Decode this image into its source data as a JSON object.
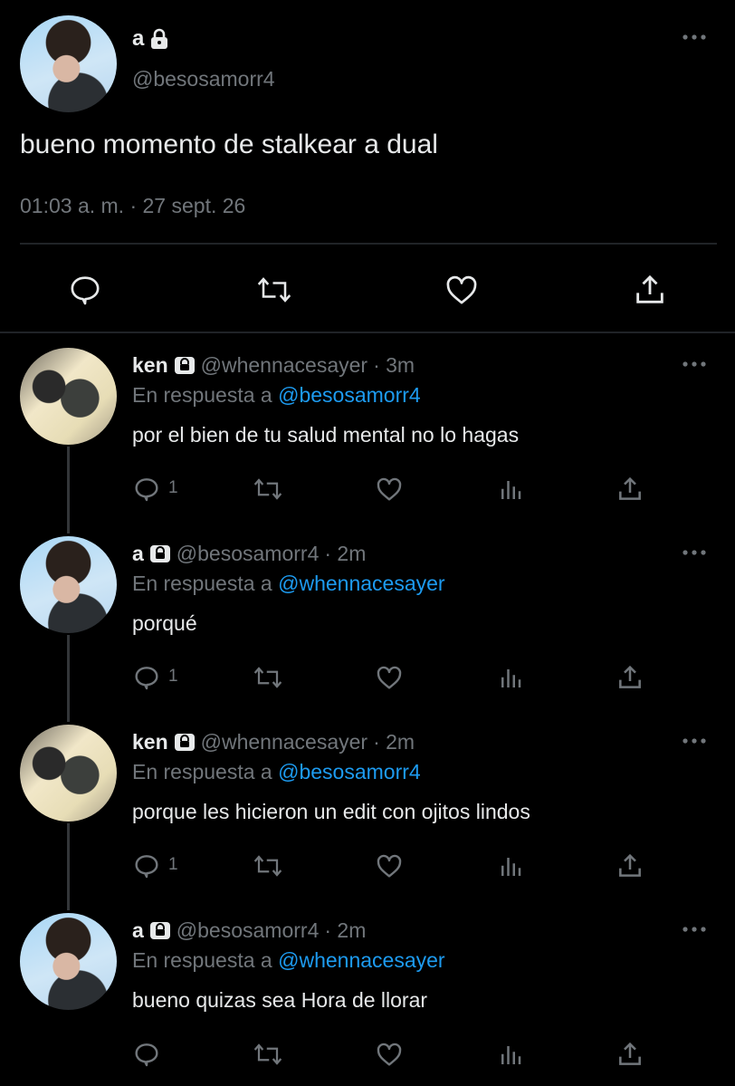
{
  "main_tweet": {
    "display_name": "a",
    "handle": "@besosamorr4",
    "text": "bueno momento de stalkear a dual",
    "timestamp": "01:03 a. m. · 27 sept. 26"
  },
  "replies": [
    {
      "display_name": "ken",
      "handle": "@whennacesayer",
      "time": "· 3m",
      "reply_prefix": "En respuesta a",
      "reply_to": "@besosamorr4",
      "text": "por el bien de tu salud mental no lo hagas",
      "reply_count": "1"
    },
    {
      "display_name": "a",
      "handle": "@besosamorr4",
      "time": "· 2m",
      "reply_prefix": "En respuesta a",
      "reply_to": "@whennacesayer",
      "text": "porqué",
      "reply_count": "1"
    },
    {
      "display_name": "ken",
      "handle": "@whennacesayer",
      "time": "· 2m",
      "reply_prefix": "En respuesta a",
      "reply_to": "@besosamorr4",
      "text": "porque les hicieron un edit con ojitos lindos",
      "reply_count": "1"
    },
    {
      "display_name": "a",
      "handle": "@besosamorr4",
      "time": "· 2m",
      "reply_prefix": "En respuesta a",
      "reply_to": "@whennacesayer",
      "text": "bueno quizas sea Hora de llorar",
      "reply_count": ""
    }
  ],
  "colors": {
    "background": "#000000",
    "text": "#e7e9ea",
    "muted": "#71767b",
    "link": "#1d9bf0",
    "divider": "#202327"
  },
  "icons": [
    "lock-icon",
    "more-icon",
    "reply-icon",
    "retweet-icon",
    "like-icon",
    "share-icon",
    "analytics-icon"
  ]
}
